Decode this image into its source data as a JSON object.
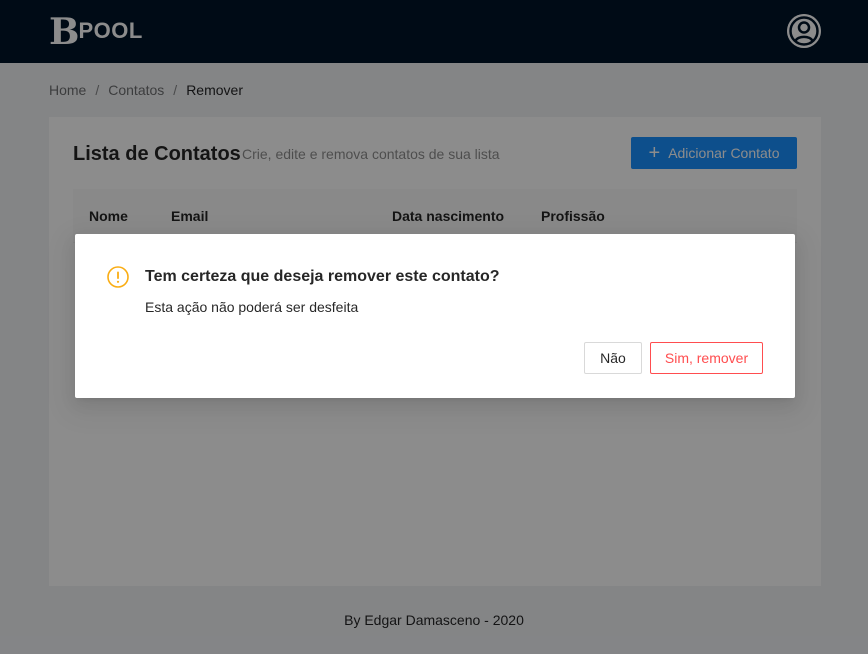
{
  "header": {
    "logo_letter": "B",
    "logo_text": "POOL",
    "avatar_icon": "user-avatar-icon"
  },
  "breadcrumb": {
    "items": [
      "Home",
      "Contatos",
      "Remover"
    ],
    "separator": "/"
  },
  "card": {
    "title": "Lista de Contatos",
    "subtitle": "Crie, edite e remova contatos de sua lista",
    "add_button_icon": "plus-icon",
    "add_button_label": "Adicionar Contato"
  },
  "table": {
    "columns": [
      "Nome",
      "Email",
      "Data nascimento",
      "Profissão"
    ]
  },
  "footer": {
    "text": "By Edgar Damasceno - 2020"
  },
  "modal": {
    "icon": "exclamation-circle-icon",
    "title": "Tem certeza que deseja remover este contato?",
    "content": "Esta ação não poderá ser desfeita",
    "cancel_label": "Não",
    "confirm_label": "Sim, remover"
  },
  "colors": {
    "header_bg": "#001529",
    "primary": "#1890ff",
    "danger": "#ff4d4f",
    "warning": "#faad14",
    "page_bg": "#f0f2f5"
  }
}
